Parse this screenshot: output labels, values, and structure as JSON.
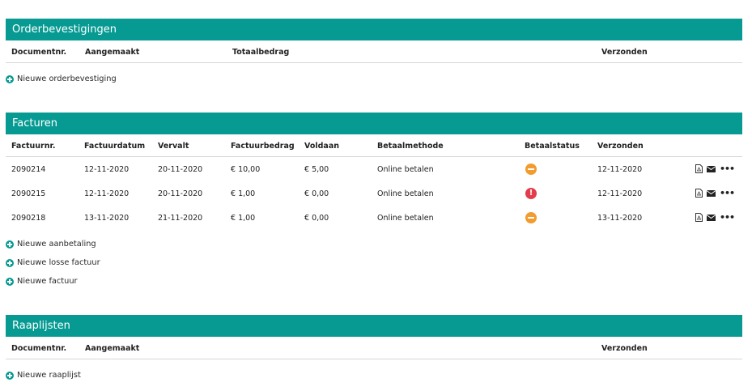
{
  "orders": {
    "title": "Orderbevestigingen",
    "columns": {
      "docnr": "Documentnr.",
      "created": "Aangemaakt",
      "total": "Totaalbedrag",
      "sent": "Verzonden"
    },
    "add_label": "Nieuwe orderbevestiging"
  },
  "invoices": {
    "title": "Facturen",
    "columns": {
      "nr": "Factuurnr.",
      "date": "Factuurdatum",
      "due": "Vervalt",
      "amount": "Factuurbedrag",
      "paid": "Voldaan",
      "method": "Betaalmethode",
      "status": "Betaalstatus",
      "sent": "Verzonden"
    },
    "rows": [
      {
        "nr": "2090214",
        "date": "12-11-2020",
        "due": "20-11-2020",
        "amount": "€ 10,00",
        "paid": "€ 5,00",
        "method": "Online betalen",
        "status": "partial",
        "sent": "12-11-2020"
      },
      {
        "nr": "2090215",
        "date": "12-11-2020",
        "due": "20-11-2020",
        "amount": "€ 1,00",
        "paid": "€ 0,00",
        "method": "Online betalen",
        "status": "error",
        "sent": "12-11-2020"
      },
      {
        "nr": "2090218",
        "date": "13-11-2020",
        "due": "21-11-2020",
        "amount": "€ 1,00",
        "paid": "€ 0,00",
        "method": "Online betalen",
        "status": "partial",
        "sent": "13-11-2020"
      }
    ],
    "error_glyph": "!",
    "more_glyph": "•••",
    "add_links": [
      "Nieuwe aanbetaling",
      "Nieuwe losse factuur",
      "Nieuwe factuur"
    ]
  },
  "picklists": {
    "title": "Raaplijsten",
    "columns": {
      "docnr": "Documentnr.",
      "created": "Aangemaakt",
      "sent": "Verzonden"
    },
    "add_label": "Nieuwe raaplijst"
  },
  "colors": {
    "accent": "#079a93",
    "status_partial": "#f29b2e",
    "status_error": "#e33c4b"
  }
}
